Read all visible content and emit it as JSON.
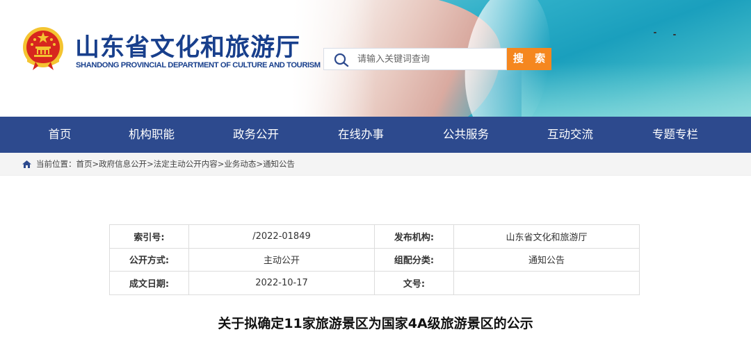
{
  "site": {
    "title_cn": "山东省文化和旅游厅",
    "title_en": "SHANDONG PROVINCIAL DEPARTMENT OF CULTURE AND TOURISM"
  },
  "search": {
    "placeholder": "请输入关键词查询",
    "button_label": "搜 索"
  },
  "nav": {
    "items": [
      {
        "label": "首页"
      },
      {
        "label": "机构职能"
      },
      {
        "label": "政务公开"
      },
      {
        "label": "在线办事"
      },
      {
        "label": "公共服务"
      },
      {
        "label": "互动交流"
      },
      {
        "label": "专题专栏"
      }
    ]
  },
  "breadcrumb": {
    "prefix": "当前位置：",
    "items": [
      "首页",
      "政府信息公开",
      "法定主动公开内容",
      "业务动态",
      "通知公告"
    ],
    "separator": ">"
  },
  "meta": {
    "rows": [
      [
        {
          "k": "索引号:",
          "v": "/2022-01849"
        },
        {
          "k": "发布机构:",
          "v": "山东省文化和旅游厅"
        }
      ],
      [
        {
          "k": "公开方式:",
          "v": "主动公开"
        },
        {
          "k": "组配分类:",
          "v": "通知公告"
        }
      ],
      [
        {
          "k": "成文日期:",
          "v": "2022-10-17"
        },
        {
          "k": "文号:",
          "v": ""
        }
      ]
    ]
  },
  "article": {
    "title": "关于拟确定11家旅游景区为国家4A级旅游景区的公示"
  },
  "colors": {
    "brand_blue": "#183f8c",
    "nav_bg": "#2d4a8e",
    "search_button": "#f5871f"
  }
}
